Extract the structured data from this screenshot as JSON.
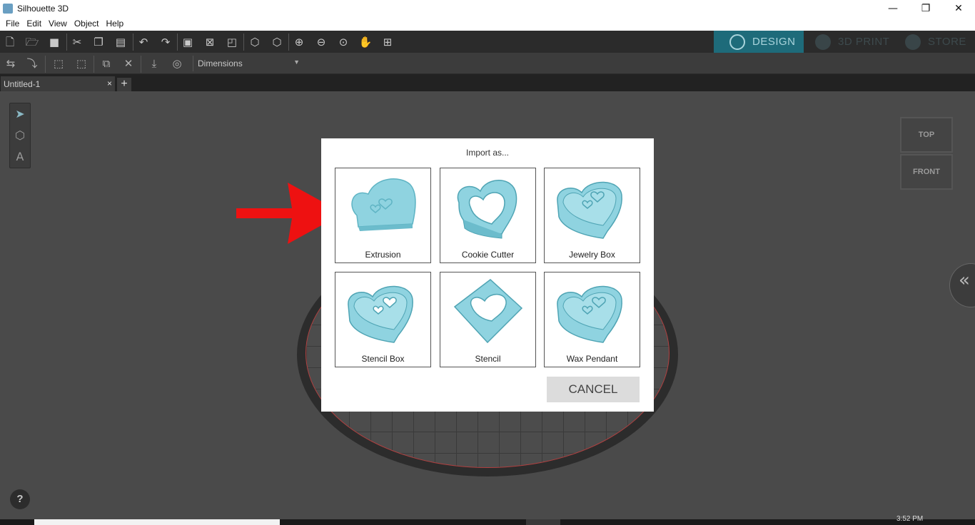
{
  "window": {
    "title": "Silhouette 3D",
    "minimize": "—",
    "maximize": "❐",
    "close": "✕"
  },
  "menu": [
    "File",
    "Edit",
    "View",
    "Object",
    "Help"
  ],
  "modes": {
    "design": "DESIGN",
    "print": "3D PRINT",
    "store": "STORE"
  },
  "toolbar2": {
    "dimensions_select": "Dimensions"
  },
  "tabs": {
    "doc_name": "Untitled-1",
    "close": "×",
    "add": "+"
  },
  "viewcube": {
    "top": "TOP",
    "front": "FRONT"
  },
  "help": "?",
  "dialog": {
    "title": "Import as...",
    "options": [
      {
        "label": "Extrusion"
      },
      {
        "label": "Cookie Cutter"
      },
      {
        "label": "Jewelry Box"
      },
      {
        "label": "Stencil Box"
      },
      {
        "label": "Stencil"
      },
      {
        "label": "Wax Pendant"
      }
    ],
    "cancel": "CANCEL"
  },
  "colors": {
    "accent": "#1e6b7a",
    "model": "#8fd3e0",
    "pointer_arrow": "#ee1111"
  },
  "taskbar": {
    "clock": "3:52 PM"
  }
}
